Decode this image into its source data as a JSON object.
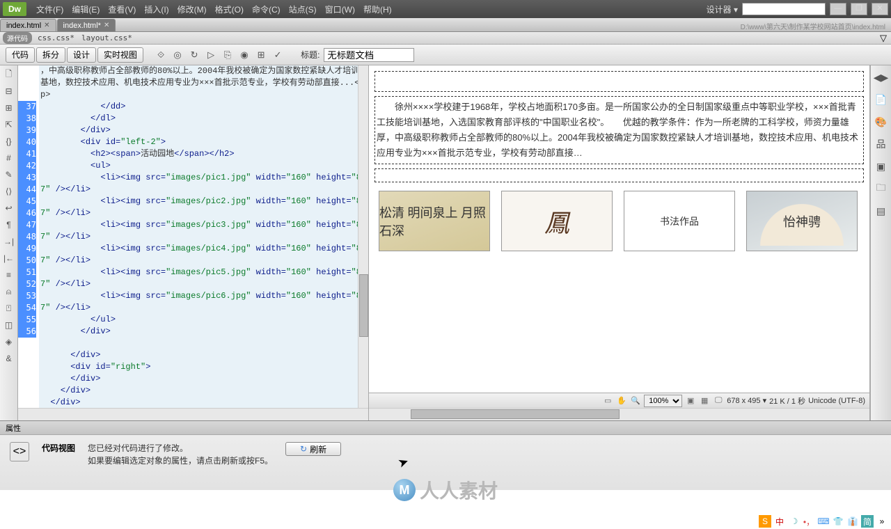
{
  "menubar": {
    "items": [
      "文件(F)",
      "编辑(E)",
      "查看(V)",
      "插入(I)",
      "修改(M)",
      "格式(O)",
      "命令(C)",
      "站点(S)",
      "窗口(W)",
      "帮助(H)"
    ],
    "designer": "设计器",
    "minimize": "—",
    "maximize": "❐",
    "close": "✕"
  },
  "doctabs": {
    "tab1": "index.html",
    "tab2": "index.html*",
    "path": "D:\\www\\第六天\\制作某学校网站首页\\index.html"
  },
  "sourcebar": {
    "pill": "源代码",
    "css1": "css.css*",
    "css2": "layout.css*"
  },
  "viewbar": {
    "code": "代码",
    "split": "拆分",
    "design": "设计",
    "live": "实时视图",
    "title_label": "标题:",
    "title_value": "无标题文档"
  },
  "code": {
    "line_start": 37,
    "top_text": "，中高级职称教师占全部教师的80%以上。2004年我校被确定为国家数控紧缺人才培训基地，数控技术应用、机电技术应用专业为×××首批示范专业，学校有劳动部直接...</p>",
    "lines": [
      "            </dd>",
      "          </dl>",
      "        </div>",
      "        <div id=\"left-2\">",
      "          <h2><span>活动园地</span></h2>",
      "          <ul>",
      "            <li><img src=\"images/pic1.jpg\" width=\"160\" height=\"87\" /></li>",
      "            <li><img src=\"images/pic2.jpg\" width=\"160\" height=\"87\" /></li>",
      "            <li><img src=\"images/pic3.jpg\" width=\"160\" height=\"87\" /></li>",
      "            <li><img src=\"images/pic4.jpg\" width=\"160\" height=\"87\" /></li>",
      "            <li><img src=\"images/pic5.jpg\" width=\"160\" height=\"87\" /></li>",
      "            <li><img src=\"images/pic6.jpg\" width=\"160\" height=\"87\" /></li>",
      "          </ul>",
      "        </div>",
      "",
      "      </div>",
      "      <div id=\"right\">",
      "      </div>",
      "    </div>",
      "  </div>"
    ]
  },
  "design": {
    "paragraph": "　　徐州××××学校建于1968年，学校占地面积170多亩。是一所国家公办的全日制国家级重点中等职业学校，×××首批青工技能培训基地，入选国家教育部评核的\"中国职业名校\"。　　优越的教学条件：作为一所老牌的工科学校，师资力量雄厚，中高级职称教师占全部教师的80%以上。2004年我校被确定为国家数控紧缺人才培训基地，数控技术应用、机电技术应用专业为×××首批示范专业，学校有劳动部直接…",
    "img1": "松清\n明间泉上\n月照石深",
    "img2": "鳳",
    "img3": "书法作品",
    "img4": "怡神骋"
  },
  "statusbar": {
    "zoom": "100%",
    "size": "678 x 495",
    "filesize": "21 K / 1 秒",
    "encoding": "Unicode (UTF-8)"
  },
  "props": {
    "tab": "属性",
    "label": "代码视图",
    "line1": "您已经对代码进行了修改。",
    "line2": "如果要编辑选定对象的属性，请点击刷新或按F5。",
    "refresh": "刷新"
  },
  "watermark": "人人素材",
  "taskbar": {
    "ime": "简",
    "lang": "中"
  }
}
